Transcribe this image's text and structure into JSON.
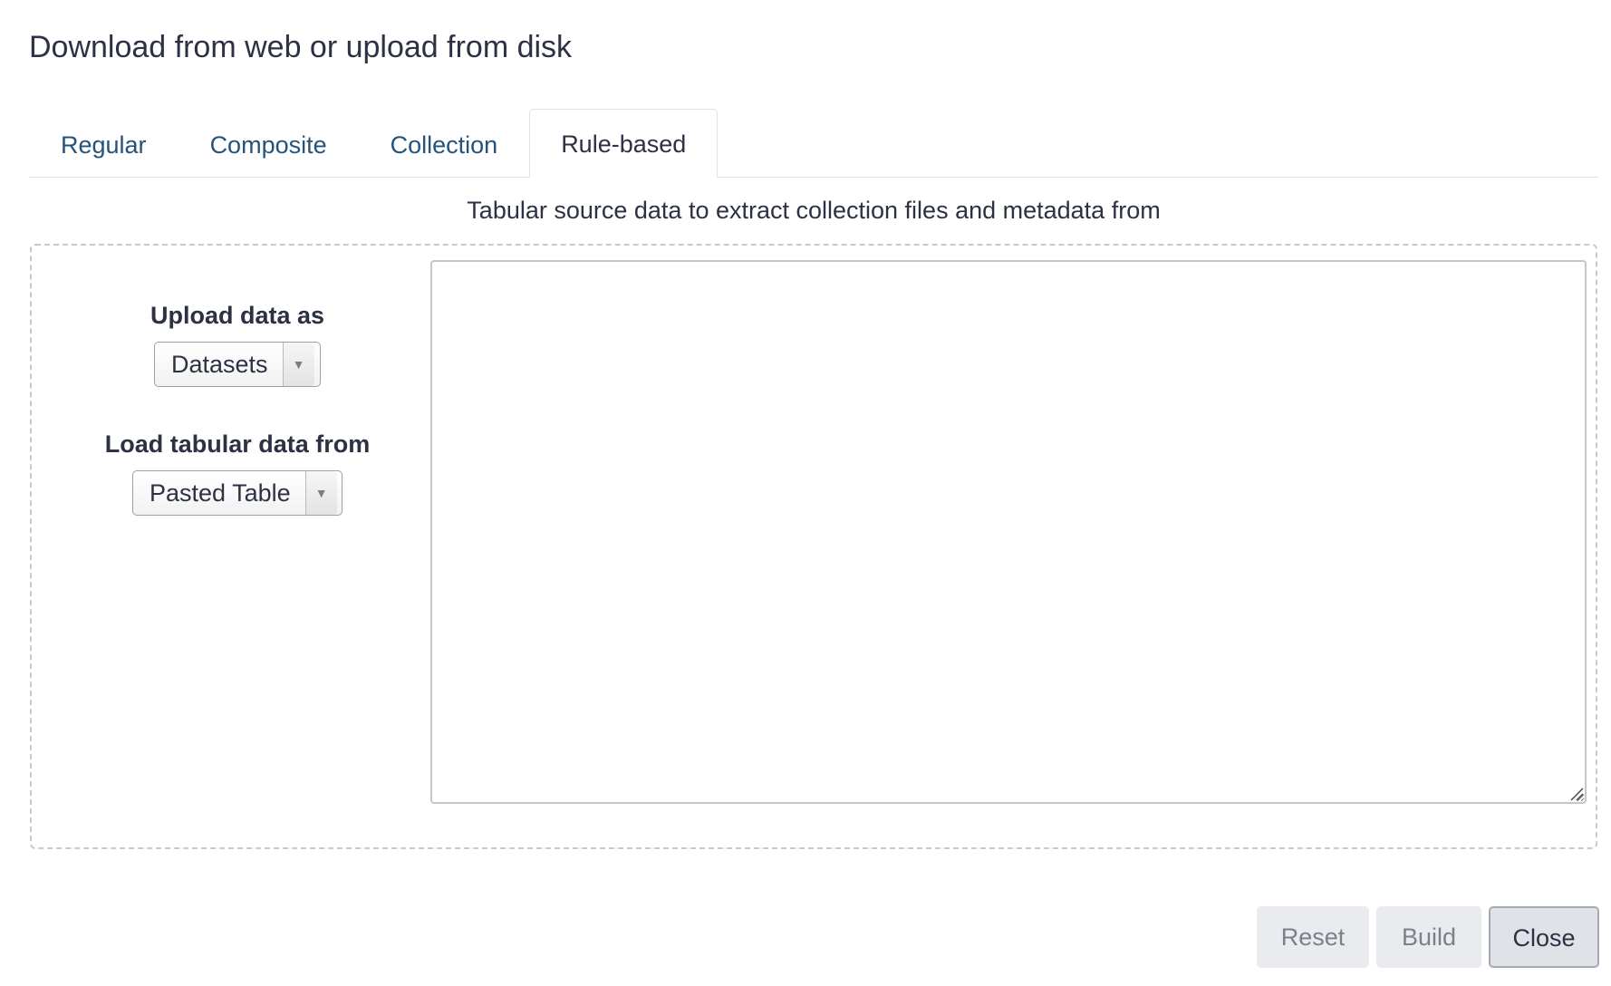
{
  "dialog": {
    "title": "Download from web or upload from disk"
  },
  "tabs": [
    {
      "label": "Regular",
      "active": false
    },
    {
      "label": "Composite",
      "active": false
    },
    {
      "label": "Collection",
      "active": false
    },
    {
      "label": "Rule-based",
      "active": true
    }
  ],
  "rule_based": {
    "subtitle": "Tabular source data to extract collection files and metadata from",
    "upload_as": {
      "label": "Upload data as",
      "selected": "Datasets"
    },
    "load_from": {
      "label": "Load tabular data from",
      "selected": "Pasted Table"
    },
    "paste_value": ""
  },
  "footer": {
    "reset_label": "Reset",
    "build_label": "Build",
    "close_label": "Close"
  },
  "icons": {
    "dropdown": "caret-down-icon",
    "resize": "resize-grip-icon"
  }
}
